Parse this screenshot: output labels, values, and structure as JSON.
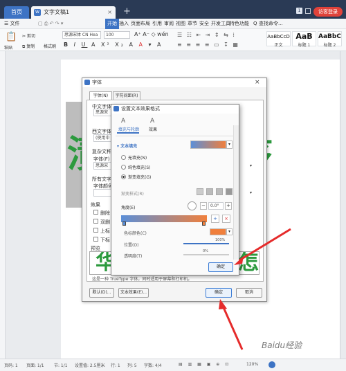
{
  "app": {
    "home_tab": "首页",
    "doc_tab": "文字文稿1",
    "doc_icon": "W",
    "close": "×",
    "new_tab": "+",
    "badge": "1",
    "login": "访客登录"
  },
  "menu": {
    "file": "☰ 文件",
    "start": "开始",
    "items": [
      "插入",
      "页面布局",
      "引用",
      "审阅",
      "视图",
      "章节",
      "安全",
      "开发工具",
      "特色功能"
    ],
    "search": "查找命令..."
  },
  "ribbon": {
    "paste": "粘贴",
    "cut": "剪切",
    "copy": "复制",
    "format_painter": "格式刷",
    "font_name": "思源宋体 CN Hea",
    "font_size": "100",
    "font_name_small": "思源宋体 CN Hea",
    "styles": [
      {
        "sample": "AaBbCcD",
        "name": "正文"
      },
      {
        "sample": "AaB",
        "name": "标题 1"
      },
      {
        "sample": "AaBbC",
        "name": "标题 2"
      }
    ]
  },
  "document": {
    "big_chars": [
      "渍",
      "序"
    ],
    "preview_chars": [
      "华",
      "怎"
    ],
    "watermark": "Baidu经验"
  },
  "font_dialog": {
    "title": "字体",
    "tabs": [
      "字体(N)",
      "字符间距(R)"
    ],
    "labels": {
      "chinese_font": "中文字体",
      "chinese_value": "思源宋",
      "western_font": "西文字体",
      "western_value": "(使用中",
      "complex": "复杂文种",
      "font_t": "字体(F)",
      "font_v": "思源宋",
      "all_text": "所有文字",
      "font_color": "字体颜色",
      "effects_group": "效果",
      "strike": "删除",
      "double": "双删",
      "sup": "上标",
      "sub": "下标",
      "preview": "预览"
    },
    "description": "这是一种 TrueType 字体，同时适用于屏幕和打印机。",
    "default_btn": "默认(D)...",
    "text_effects_btn": "文本效果(E)...",
    "ok_btn": "确定",
    "cancel_btn": "取消"
  },
  "effects_dialog": {
    "title": "设置文本效果格式",
    "tabs": [
      "填充与轮廓",
      "效果"
    ],
    "section": "文本填充",
    "options": [
      "无填充(N)",
      "纯色填充(S)",
      "渐变填充(G)"
    ],
    "preset": "渐变样式(R)",
    "angle_label": "角度(E)",
    "angle_value": "0.0°",
    "color_label": "色标颜色(C)",
    "position_label": "位置(O)",
    "position_value": "100%",
    "transparency_label": "透明度(T)",
    "transparency_value": "0%",
    "ok": "确定"
  },
  "status": {
    "page": "页码: 1",
    "pages": "页面: 1/1",
    "section": "节: 1/1",
    "setting": "设置值: 2.5厘米",
    "row": "行: 1",
    "col": "列: 5",
    "words": "字数: 4/4",
    "zoom": "120%"
  },
  "colors": {
    "accent": "#3d73c4",
    "green": "#2c9a3e",
    "arrow": "#e52b2b",
    "gradient_start": "#5b8fd8",
    "gradient_end": "#f07f3c"
  }
}
